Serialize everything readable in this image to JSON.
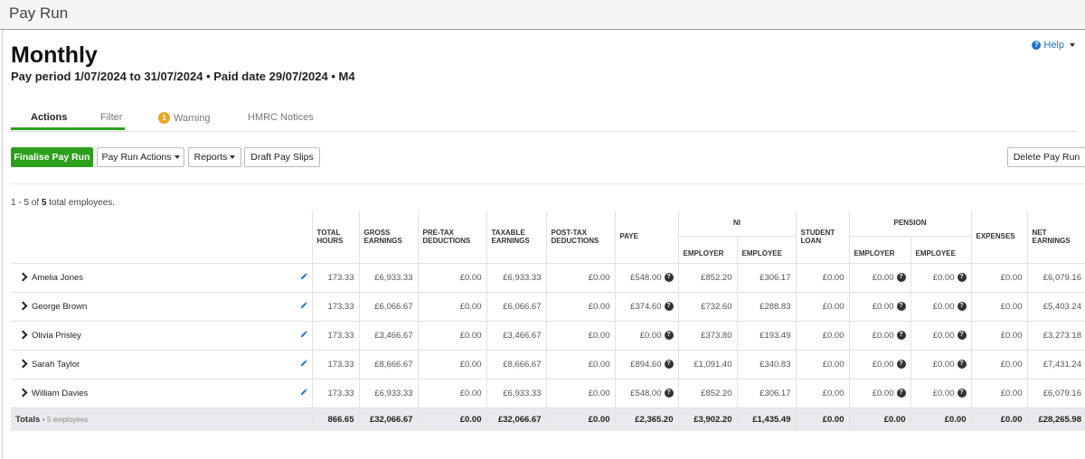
{
  "app": {
    "title": "Pay Run"
  },
  "help": {
    "label": "Help"
  },
  "header": {
    "title": "Monthly",
    "subtitle": "Pay period 1/07/2024 to 31/07/2024 • Paid date 29/07/2024 • M4"
  },
  "tabs": [
    {
      "label": "Actions",
      "active": true
    },
    {
      "label": "Filter"
    },
    {
      "label": "Warning",
      "badge": "1"
    },
    {
      "label": "HMRC Notices"
    }
  ],
  "toolbar": {
    "finalise": "Finalise Pay Run",
    "pay_run_actions": "Pay Run Actions",
    "reports": "Reports",
    "draft_pay_slips": "Draft Pay Slips",
    "delete": "Delete Pay Run"
  },
  "summary": {
    "prefix": "1 - 5 of ",
    "total": "5",
    "suffix": " total employees."
  },
  "columns": {
    "total_hours": "TOTAL HOURS",
    "gross": "GROSS EARNINGS",
    "pretax": "PRE-TAX DEDUCTIONS",
    "taxable": "TAXABLE EARNINGS",
    "posttax": "POST-TAX DEDUCTIONS",
    "paye": "PAYE",
    "ni_group": "NI",
    "ni_employer": "EMPLOYER",
    "ni_employee": "EMPLOYEE",
    "student_loan": "STUDENT LOAN",
    "pension_group": "PENSION",
    "pension_employer": "EMPLOYER",
    "pension_employee": "EMPLOYEE",
    "expenses": "EXPENSES",
    "net": "NET EARNINGS"
  },
  "rows": [
    {
      "name": "Amelia Jones",
      "hours": "173.33",
      "gross": "£6,933.33",
      "pretax": "£0.00",
      "taxable": "£6,933.33",
      "posttax": "£0.00",
      "paye": "£548.00",
      "ni_er": "£852.20",
      "ni_ee": "£306.17",
      "sl": "£0.00",
      "pen_er": "£0.00",
      "pen_ee": "£0.00",
      "exp": "£0.00",
      "net": "£6,079.16"
    },
    {
      "name": "George Brown",
      "hours": "173.33",
      "gross": "£6,066.67",
      "pretax": "£0.00",
      "taxable": "£6,066.67",
      "posttax": "£0.00",
      "paye": "£374.60",
      "ni_er": "£732.60",
      "ni_ee": "£288.83",
      "sl": "£0.00",
      "pen_er": "£0.00",
      "pen_ee": "£0.00",
      "exp": "£0.00",
      "net": "£5,403.24"
    },
    {
      "name": "Olivia Prisley",
      "hours": "173.33",
      "gross": "£3,466.67",
      "pretax": "£0.00",
      "taxable": "£3,466.67",
      "posttax": "£0.00",
      "paye": "£0.00",
      "ni_er": "£373.80",
      "ni_ee": "£193.49",
      "sl": "£0.00",
      "pen_er": "£0.00",
      "pen_ee": "£0.00",
      "exp": "£0.00",
      "net": "£3,273.18"
    },
    {
      "name": "Sarah Taylor",
      "hours": "173.33",
      "gross": "£8,666.67",
      "pretax": "£0.00",
      "taxable": "£8,666.67",
      "posttax": "£0.00",
      "paye": "£894.60",
      "ni_er": "£1,091.40",
      "ni_ee": "£340.83",
      "sl": "£0.00",
      "pen_er": "£0.00",
      "pen_ee": "£0.00",
      "exp": "£0.00",
      "net": "£7,431.24"
    },
    {
      "name": "William Davies",
      "hours": "173.33",
      "gross": "£6,933.33",
      "pretax": "£0.00",
      "taxable": "£6,933.33",
      "posttax": "£0.00",
      "paye": "£548.00",
      "ni_er": "£852.20",
      "ni_ee": "£306.17",
      "sl": "£0.00",
      "pen_er": "£0.00",
      "pen_ee": "£0.00",
      "exp": "£0.00",
      "net": "£6,079.16"
    }
  ],
  "totals": {
    "label": "Totals",
    "sub": "• 5 employees",
    "hours": "866.65",
    "gross": "£32,066.67",
    "pretax": "£0.00",
    "taxable": "£32,066.67",
    "posttax": "£0.00",
    "paye": "£2,365.20",
    "ni_er": "£3,902.20",
    "ni_ee": "£1,435.49",
    "sl": "£0.00",
    "pen_er": "£0.00",
    "pen_ee": "£0.00",
    "exp": "£0.00",
    "net": "£28,265.98"
  },
  "colors": {
    "accent": "#2ca01c",
    "link": "#1f73c9",
    "badge": "#e9a822"
  }
}
